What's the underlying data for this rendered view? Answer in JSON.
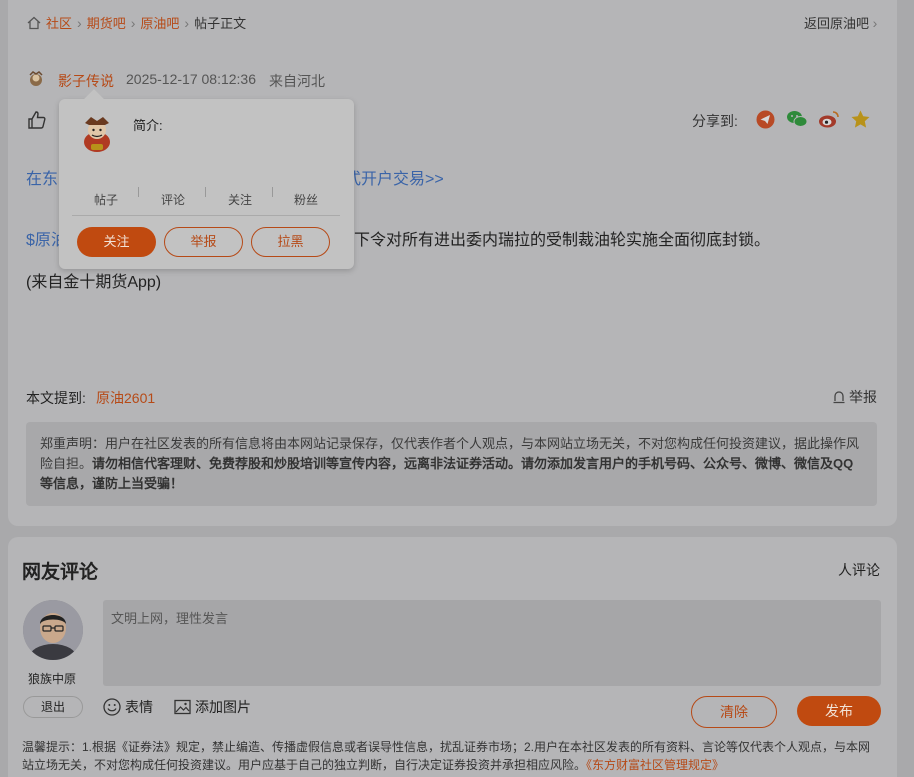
{
  "breadcrumb": {
    "home": "社区",
    "futures": "期货吧",
    "crude": "原油吧",
    "current": "帖子正文",
    "back": "返回原油吧"
  },
  "post": {
    "author": "影子传说",
    "datetime": "2025-12-17 08:12:36",
    "location": "来自河北",
    "share_label": "分享到:",
    "link_prefix": "在东",
    "link_suffix": "式开户交易>>",
    "stock_tag_prefix": "$原油",
    "body_text": "下令对所有进出委内瑞拉的受制裁油轮实施全面彻底封锁。",
    "source": "(来自金十期货App)",
    "mention_label": "本文提到:",
    "mention_value": "原油2601",
    "report": "举报",
    "disclaimer_normal": "郑重声明：用户在社区发表的所有信息将由本网站记录保存，仅代表作者个人观点，与本网站立场无关，不对您构成任何投资建议，据此操作风险自担。",
    "disclaimer_bold": "请勿相信代客理财、免费荐股和炒股培训等宣传内容，远离非法证券活动。请勿添加发言用户的手机号码、公众号、微博、微信及QQ等信息，谨防上当受骗！"
  },
  "popup": {
    "intro_label": "简介:",
    "stats": [
      "帖子",
      "评论",
      "关注",
      "粉丝"
    ],
    "follow": "关注",
    "report": "举报",
    "block": "拉黑"
  },
  "comments": {
    "title": "网友评论",
    "count_label": "人评论",
    "user_name": "狼族中原",
    "logout": "退出",
    "placeholder": "文明上网，理性发言",
    "emoji": "表情",
    "add_image": "添加图片",
    "clear": "清除",
    "publish": "发布",
    "notice": "温馨提示：1.根据《证券法》规定，禁止编造、传播虚假信息或者误导性信息，扰乱证券市场；2.用户在本社区发表的所有资料、言论等仅代表个人观点，与本网站立场无关，不对您构成任何投资建议。用户应基于自己的独立判断，自行决定证券投资并承担相应风险。",
    "rules_link": "《东方财富社区管理规定》"
  },
  "colors": {
    "accent": "#c04a10",
    "link": "#3a64a8",
    "overlay": "#a9a9ab"
  },
  "icons": [
    "home-icon",
    "chevron-right-icon",
    "thumbs-up-icon",
    "share-telegram-icon",
    "share-wechat-icon",
    "share-weibo-icon",
    "favorite-star-icon",
    "report-icon",
    "emoji-icon",
    "image-icon"
  ]
}
